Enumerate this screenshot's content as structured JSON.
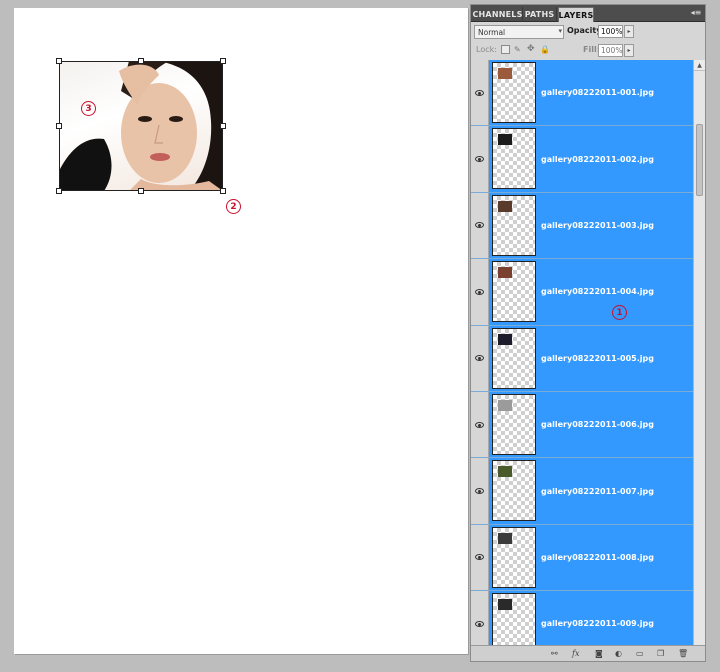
{
  "canvas": {
    "markers": [
      "1",
      "2",
      "3"
    ]
  },
  "panel": {
    "tabs": [
      "CHANNELS",
      "PATHS",
      "LAYERS"
    ],
    "active_tab": "LAYERS",
    "blend_mode": "Normal",
    "opacity_label": "Opacity:",
    "opacity_value": "100%",
    "lock_label": "Lock:",
    "fill_label": "Fill:",
    "fill_value": "100%",
    "layers": [
      {
        "name": "gallery08222011-001.jpg",
        "thumb_color": "#9c5a3c"
      },
      {
        "name": "gallery08222011-002.jpg",
        "thumb_color": "#1b1b1b"
      },
      {
        "name": "gallery08222011-003.jpg",
        "thumb_color": "#5a3a2a"
      },
      {
        "name": "gallery08222011-004.jpg",
        "thumb_color": "#7a4030"
      },
      {
        "name": "gallery08222011-005.jpg",
        "thumb_color": "#1c1c2a"
      },
      {
        "name": "gallery08222011-006.jpg",
        "thumb_color": "#9b9b9b"
      },
      {
        "name": "gallery08222011-007.jpg",
        "thumb_color": "#4a5a2a"
      },
      {
        "name": "gallery08222011-008.jpg",
        "thumb_color": "#3a3a3a"
      },
      {
        "name": "gallery08222011-009.jpg",
        "thumb_color": "#2a2a2a"
      }
    ],
    "footer_icons": [
      "link-icon",
      "fx-icon",
      "mask-icon",
      "adjustment-icon",
      "folder-icon",
      "new-layer-icon",
      "trash-icon"
    ],
    "colors": {
      "selection": "#3399ff",
      "tabbar": "#4d4d4d"
    }
  }
}
